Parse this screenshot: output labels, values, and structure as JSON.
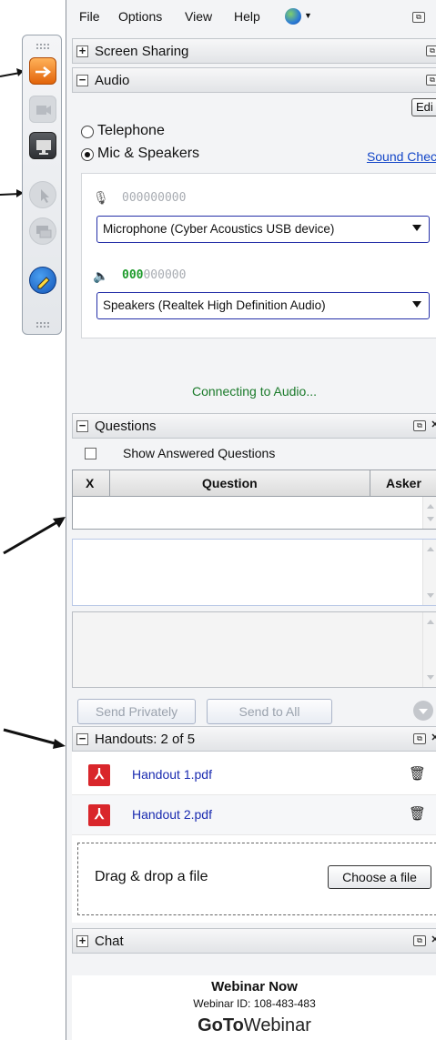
{
  "menubar": {
    "file": "File",
    "options": "Options",
    "view": "View",
    "help": "Help"
  },
  "sections": {
    "screen_sharing": {
      "title": "Screen Sharing"
    },
    "audio": {
      "title": "Audio",
      "edit_label": "Edi",
      "telephone_label": "Telephone",
      "mic_label": "Mic & Speakers",
      "selected": "Mic & Speakers",
      "sound_check": "Sound Chec",
      "mic_level": "000000000",
      "speaker_level_lit": "000",
      "speaker_level_unlit": "000000",
      "microphone_device": "Microphone (Cyber Acoustics USB device)",
      "speaker_device": "Speakers (Realtek High Definition Audio)",
      "status": "Connecting to Audio..."
    },
    "questions": {
      "title": "Questions",
      "show_answered": "Show Answered Questions",
      "show_answered_checked": false,
      "columns": {
        "x": "X",
        "question": "Question",
        "asker": "Asker"
      },
      "send_privately": "Send Privately",
      "send_to_all": "Send to All"
    },
    "handouts": {
      "title": "Handouts: 2 of 5",
      "files": [
        {
          "name": "Handout 1.pdf"
        },
        {
          "name": "Handout 2.pdf"
        }
      ],
      "drop_text": "Drag & drop a file",
      "choose_button": "Choose a file"
    },
    "chat": {
      "title": "Chat"
    }
  },
  "footer": {
    "webinar_title": "Webinar Now",
    "webinar_id": "Webinar ID: 108-483-483",
    "logo_bold": "GoTo",
    "logo_rest": "Webinar"
  },
  "colors": {
    "link": "#1346c8",
    "status_green": "#1a7a2a",
    "pdf_red": "#d9262b",
    "level_green": "#1e9b2c"
  },
  "icons": {
    "toolbar": [
      "show-panel-arrow-icon",
      "webcam-icon",
      "screen-share-icon",
      "pointer-icon",
      "chat-bubble-icon",
      "drawing-tool-icon"
    ]
  }
}
